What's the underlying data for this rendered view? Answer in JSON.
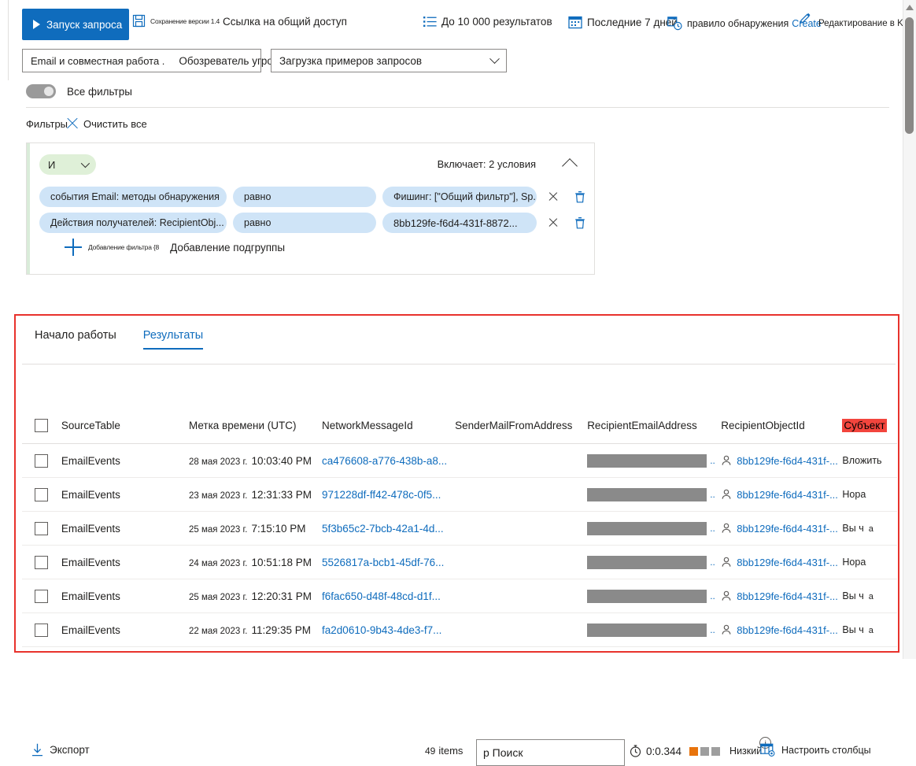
{
  "toolbar": {
    "run_query": "Запуск запроса",
    "save_version": "Сохранение версии 1.4",
    "share_link": "Ссылка на общий доступ",
    "results_cap": "До 10 000 результатов",
    "date_range": "Последние 7 дней",
    "detection_rule": "правило обнаружения",
    "detection_rule_create": "Create",
    "edit_in_kql": "Редактирование в KQL",
    "accent_color": "#0f6cbd"
  },
  "pickers": {
    "scope_primary": "Email и совместная работа .",
    "scope_secondary": "Обозреватель угроз",
    "sample_queries": "Загрузка примеров запросов"
  },
  "filters_toggle": {
    "label": "Все фильтры",
    "on": false
  },
  "filters_bar": {
    "label": "Фильтры",
    "clear_all": "Очистить все"
  },
  "filter_group": {
    "operator": "И",
    "summary": "Включает: 2 условия",
    "conditions": [
      {
        "field": "события Email: методы обнаружения",
        "operator": "равно",
        "value": "Фишинг: [\"Общий фильтр\"], Sp..."
      },
      {
        "field": "Действия получателей: RecipientObj...",
        "operator": "равно",
        "value": "8bb129fe-f6d4-431f-8872..."
      }
    ],
    "add_filter": "Добавление фильтра {8",
    "add_subgroup": "Добавление подгруппы"
  },
  "tabs": [
    {
      "label": "Начало работы",
      "active": false
    },
    {
      "label": "Результаты",
      "active": true
    }
  ],
  "results_toolbar": {
    "export": "Экспорт",
    "item_count": "49",
    "item_unit": "items",
    "search_value": "р Поиск",
    "search_placeholder": "Поиск",
    "duration": "0:0.344",
    "severity": "Низкий",
    "severity_info": "i",
    "severity_bar_colors": [
      "#e8730c",
      "#9e9e9e",
      "#9e9e9e"
    ],
    "configure_columns": "Настроить столбцы"
  },
  "table": {
    "columns": [
      "SourceTable",
      "Метка времени (UTC)",
      "NetworkMessageId",
      "SenderMailFromAddress",
      "RecipientEmailAddress",
      "RecipientObjectId",
      "Субъект"
    ],
    "subject_header_highlight": "#f2453d",
    "rows": [
      {
        "source_table": "EmailEvents",
        "date": "28 мая 2023 г.",
        "time": "10:03:40 PM",
        "network_message_id": "ca476608-a776-438b-a8...",
        "sender_mail_from": "[redacted]",
        "recipient_email": "[redacted]",
        "recipient_object_id": "8bb129fe-f6d4-431f-...",
        "subject": "Вложить",
        "subject_extra": ""
      },
      {
        "source_table": "EmailEvents",
        "date": "23 мая 2023 г.",
        "time": "12:31:33 PM",
        "network_message_id": "971228df-ff42-478c-0f5...",
        "sender_mail_from": "[redacted]",
        "recipient_email": "[redacted]",
        "recipient_object_id": "8bb129fe-f6d4-431f-...",
        "subject": "Нора",
        "subject_extra": ""
      },
      {
        "source_table": "EmailEvents",
        "date": "25 мая 2023 г.",
        "time": "7:15:10 PM",
        "network_message_id": "5f3b65c2-7bcb-42a1-4d...",
        "sender_mail_from": "[redacted]",
        "recipient_email": "[redacted]",
        "recipient_object_id": "8bb129fe-f6d4-431f-...",
        "subject": "Вы ч",
        "subject_extra": "а"
      },
      {
        "source_table": "EmailEvents",
        "date": "24 мая 2023 г.",
        "time": "10:51:18 PM",
        "network_message_id": "5526817a-bcb1-45df-76...",
        "sender_mail_from": "[redacted]",
        "recipient_email": "[redacted]",
        "recipient_object_id": "8bb129fe-f6d4-431f-...",
        "subject": "Нора",
        "subject_extra": ""
      },
      {
        "source_table": "EmailEvents",
        "date": "25 мая 2023 г.",
        "time": "12:20:31 PM",
        "network_message_id": "f6fac650-d48f-48cd-d1f...",
        "sender_mail_from": "[redacted]",
        "recipient_email": "[redacted]",
        "recipient_object_id": "8bb129fe-f6d4-431f-...",
        "subject": "Вы ч",
        "subject_extra": "а"
      },
      {
        "source_table": "EmailEvents",
        "date": "22 мая 2023 г.",
        "time": "11:29:35 PM",
        "network_message_id": "fa2d0610-9b43-4de3-f7...",
        "sender_mail_from": "[redacted]",
        "recipient_email": "[redacted]",
        "recipient_object_id": "8bb129fe-f6d4-431f-...",
        "subject": "Вы ч",
        "subject_extra": "а"
      }
    ]
  },
  "highlight": {
    "color": "#e8322c"
  }
}
